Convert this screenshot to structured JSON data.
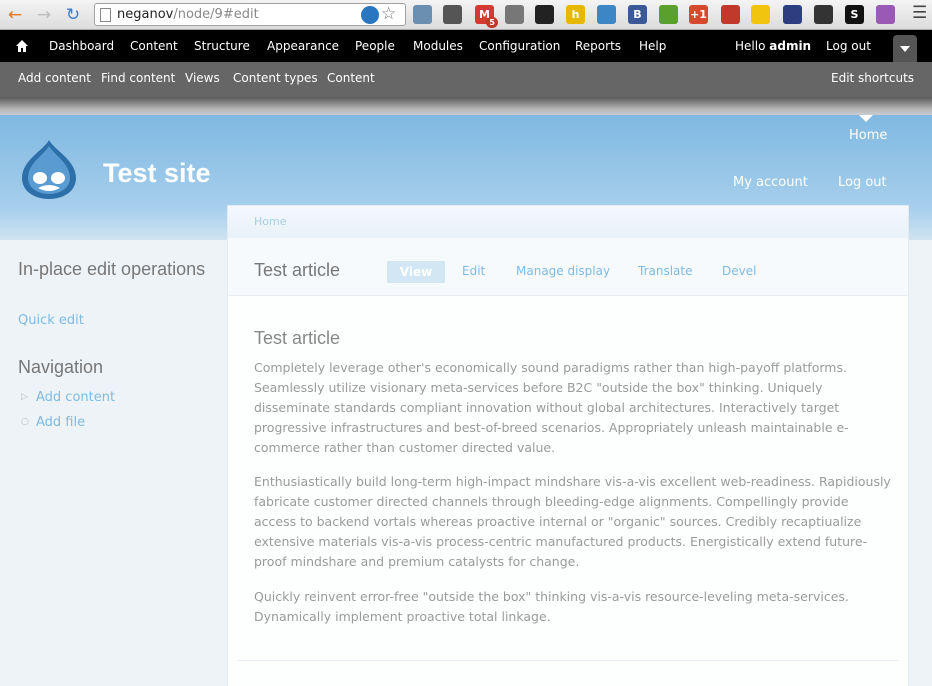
{
  "browser": {
    "url_host": "neganov",
    "url_path": "/node/9#edit",
    "extensions": [
      {
        "icon": "search-ext-icon",
        "color": "#6a8fb0",
        "glyph": ""
      },
      {
        "icon": "hat-ext-icon",
        "color": "#555555",
        "glyph": ""
      },
      {
        "icon": "gmail-ext-icon",
        "color": "#d33b2f",
        "glyph": "M",
        "badge": "5"
      },
      {
        "icon": "keyboard-ext-icon",
        "color": "#777777",
        "glyph": ""
      },
      {
        "icon": "qr-ext-icon",
        "color": "#222222",
        "glyph": ""
      },
      {
        "icon": "h-ext-icon",
        "color": "#e6b800",
        "glyph": "h"
      },
      {
        "icon": "picture-ext-icon",
        "color": "#3d86c6",
        "glyph": ""
      },
      {
        "icon": "b-ext-icon",
        "color": "#3b5998",
        "glyph": "B"
      },
      {
        "icon": "evernote-ext-icon",
        "color": "#5aa02c",
        "glyph": ""
      },
      {
        "icon": "gplus-ext-icon",
        "color": "#d6492d",
        "glyph": "+1"
      },
      {
        "icon": "book-ext-icon",
        "color": "#c0392b",
        "glyph": ""
      },
      {
        "icon": "note-ext-icon",
        "color": "#f1c40f",
        "glyph": ""
      },
      {
        "icon": "shield-ext-icon",
        "color": "#2c3e80",
        "glyph": ""
      },
      {
        "icon": "gear-ext-icon",
        "color": "#333333",
        "glyph": ""
      },
      {
        "icon": "s-ext-icon",
        "color": "#111111",
        "glyph": "S"
      },
      {
        "icon": "color-ext-icon",
        "color": "#9b59b6",
        "glyph": ""
      }
    ]
  },
  "toolbar": {
    "items": [
      "Dashboard",
      "Content",
      "Structure",
      "Appearance",
      "People",
      "Modules",
      "Configuration",
      "Reports",
      "Help"
    ],
    "hello": "Hello",
    "user": "admin",
    "logout": "Log out"
  },
  "shortcuts": {
    "items": [
      "Add content",
      "Find content",
      "Views",
      "Content types",
      "Content"
    ],
    "edit": "Edit shortcuts"
  },
  "header": {
    "site_name": "Test site",
    "home": "Home",
    "my_account": "My account",
    "log_out": "Log out"
  },
  "sidebar": {
    "block1_title": "In-place edit operations",
    "quick_edit": "Quick edit",
    "block2_title": "Navigation",
    "nav_items": [
      "Add content",
      "Add file"
    ]
  },
  "main": {
    "breadcrumb": "Home",
    "page_title": "Test article",
    "tabs": [
      "View",
      "Edit",
      "Manage display",
      "Translate",
      "Devel"
    ],
    "node_title": "Test article",
    "paragraphs": [
      "Completely leverage other's economically sound paradigms rather than high-payoff platforms. Seamlessly utilize visionary meta-services before B2C \"outside the box\" thinking. Uniquely disseminate standards compliant innovation without global architectures. Interactively target progressive infrastructures and best-of-breed scenarios. Appropriately unleash maintainable e-commerce rather than customer directed value.",
      "Enthusiastically build long-term high-impact mindshare vis-a-vis excellent web-readiness. Rapidiously fabricate customer directed channels through bleeding-edge alignments. Compellingly provide access to backend vortals whereas proactive internal or \"organic\" sources. Credibly recaptiualize extensive materials vis-a-vis process-centric manufactured products. Energistically extend future-proof mindshare and premium catalysts for change.",
      "Quickly reinvent error-free \"outside the box\" thinking vis-a-vis resource-leveling meta-services. Dynamically implement proactive total linkage."
    ]
  }
}
